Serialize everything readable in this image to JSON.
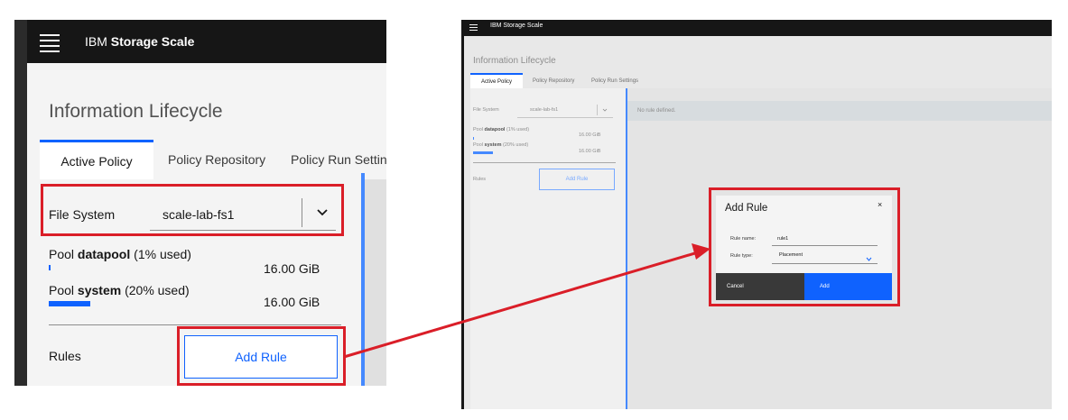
{
  "app": {
    "brand_prefix": "IBM",
    "brand_name": "Storage Scale"
  },
  "page": {
    "title": "Information Lifecycle",
    "tabs": [
      {
        "label": "Active Policy",
        "active": true
      },
      {
        "label": "Policy Repository",
        "active": false
      },
      {
        "label": "Policy Run Settings",
        "active": false
      }
    ]
  },
  "filesystem": {
    "label": "File System",
    "value": "scale-lab-fs1"
  },
  "pools": [
    {
      "prefix": "Pool",
      "name": "datapool",
      "usage": "(1% used)",
      "size": "16.00 GiB",
      "used_fraction": 0.01
    },
    {
      "prefix": "Pool",
      "name": "system",
      "usage": "(20% used)",
      "size": "16.00 GiB",
      "used_fraction": 0.2
    }
  ],
  "rules": {
    "label": "Rules",
    "add_button": "Add Rule"
  },
  "main": {
    "empty_message": "No rule defined."
  },
  "dialog": {
    "title": "Add Rule",
    "close": "×",
    "rule_name_label": "Rule name:",
    "rule_name_value": "rule1",
    "rule_type_label": "Rule type:",
    "rule_type_value": "Placement",
    "cancel": "Cancel",
    "add": "Add"
  },
  "colors": {
    "accent": "#0f62fe",
    "highlight": "#da1e28",
    "header": "#161616"
  },
  "icons": {
    "menu": "hamburger-menu-icon",
    "dropdown": "chevron-down-icon",
    "close": "close-icon"
  }
}
